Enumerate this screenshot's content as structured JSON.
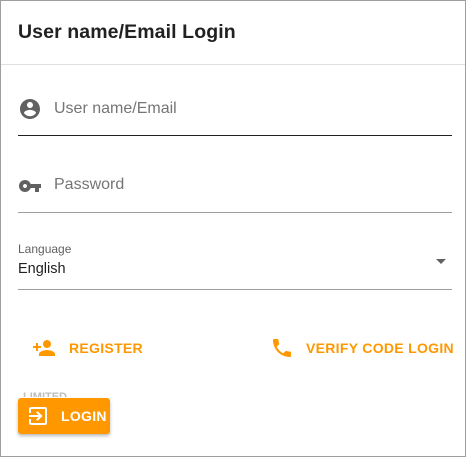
{
  "dialog": {
    "title": "User name/Email Login"
  },
  "form": {
    "username": {
      "placeholder": "User name/Email",
      "icon": "account-circle-icon"
    },
    "password": {
      "placeholder": "Password",
      "icon": "key-icon"
    },
    "language": {
      "label": "Language",
      "value": "English"
    }
  },
  "actions": {
    "register_label": "REGISTER",
    "verify_code_label": "VERIFY CODE LOGIN",
    "login_label": "LOGIN",
    "faint_label": "LIMITED"
  },
  "colors": {
    "accent": "#ff9800",
    "text": "#212121",
    "muted": "#757575"
  }
}
